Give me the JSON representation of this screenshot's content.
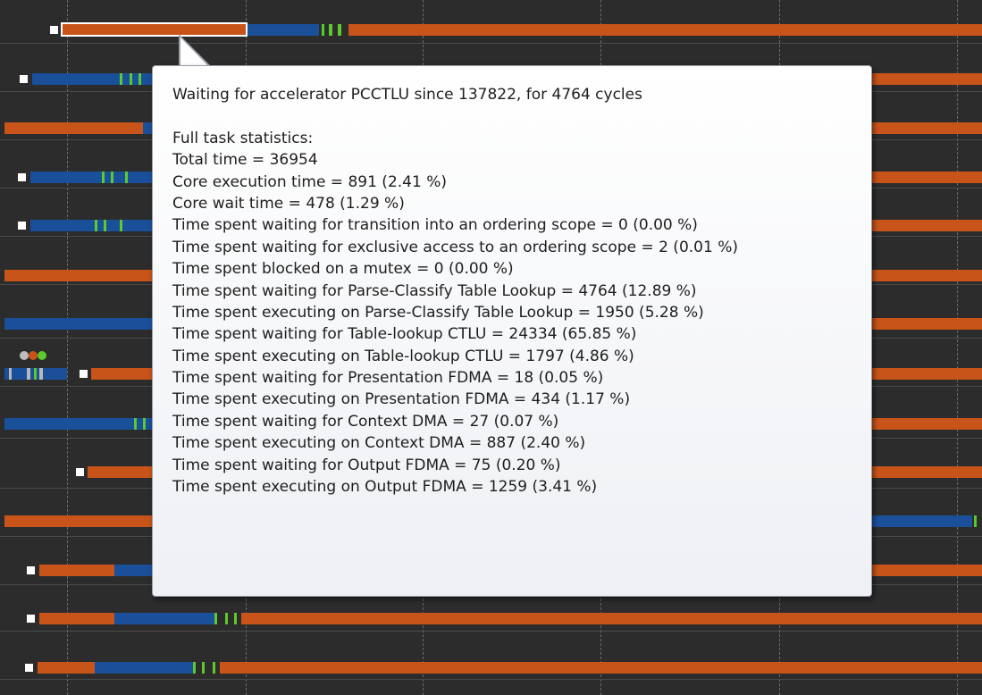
{
  "tooltip": {
    "headline": "Waiting for accelerator PCCTLU since 137822, for 4764 cycles",
    "stats_title": "Full task statistics:",
    "stats": [
      "Total time = 36954",
      "Core execution time = 891 (2.41 %)",
      "Core wait time = 478 (1.29 %)",
      "Time spent waiting for transition into an ordering scope = 0 (0.00 %)",
      "Time spent waiting for exclusive access to an ordering scope = 2 (0.01 %)",
      "Time spent blocked on a mutex = 0 (0.00 %)",
      "Time spent waiting for Parse-Classify Table Lookup = 4764 (12.89 %)",
      "Time spent executing on Parse-Classify Table Lookup = 1950 (5.28 %)",
      "Time spent waiting for Table-lookup CTLU = 24334 (65.85 %)",
      "Time spent executing on Table-lookup CTLU = 1797 (4.86 %)",
      "Time spent waiting for Presentation FDMA = 18 (0.05 %)",
      "Time spent executing on Presentation FDMA = 434 (1.17 %)",
      "Time spent waiting for Context DMA = 27 (0.07 %)",
      "Time spent executing on Context DMA = 887 (2.40 %)",
      "Time spent waiting for Output FDMA = 75 (0.20 %)",
      "Time spent executing on Output FDMA = 1259 (3.41 %)"
    ]
  },
  "colors": {
    "background": "#2c2c2c",
    "executing": "#c8541a",
    "waiting": "#1a4f9a",
    "accelerator": "#5ec92d",
    "marker": "#ffffff"
  }
}
